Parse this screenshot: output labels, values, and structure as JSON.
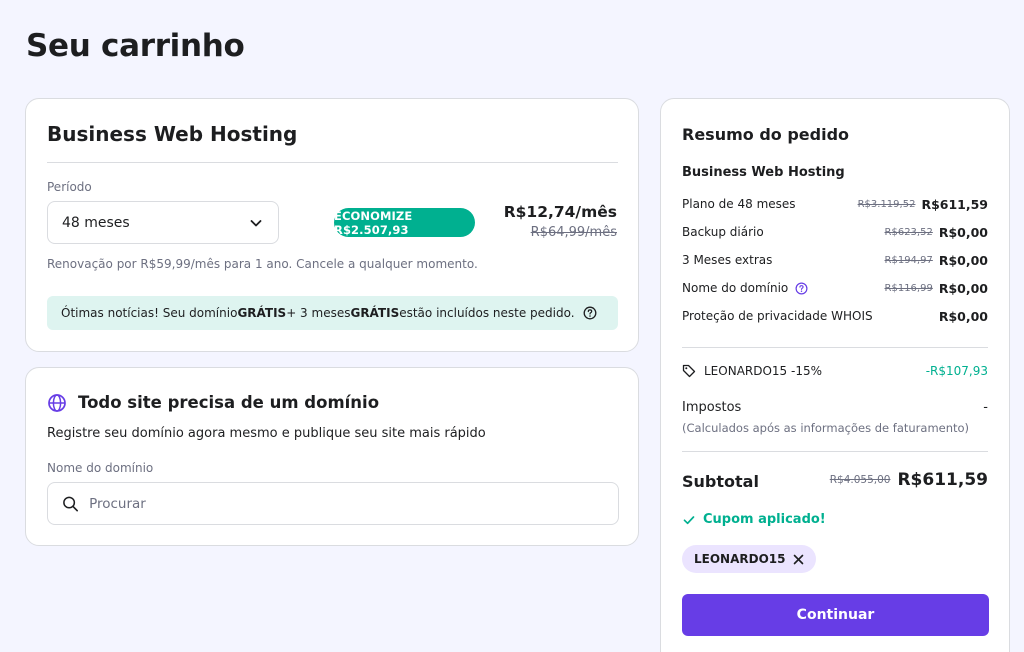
{
  "page": {
    "title": "Seu carrinho"
  },
  "plan": {
    "title": "Business Web Hosting",
    "period_label": "Período",
    "period_value": "48 meses",
    "save_badge": "ECONOMIZE R$2.507,93",
    "price": "R$12,74/mês",
    "old_price": "R$64,99/mês",
    "renewal": "Renovação por R$59,99/mês para 1 ano. Cancele a qualquer momento.",
    "promo": {
      "part1": "Ótimas notícias! Seu domínio ",
      "bold1": "GRÁTIS",
      "part2": " + 3 meses ",
      "bold2": "GRÁTIS",
      "part3": " estão incluídos neste pedido."
    }
  },
  "domain": {
    "title": "Todo site precisa de um domínio",
    "subtitle": "Registre seu domínio agora mesmo e publique seu site mais rápido",
    "label": "Nome do domínio",
    "placeholder": "Procurar"
  },
  "summary": {
    "title": "Resumo do pedido",
    "product": "Business Web Hosting",
    "items": [
      {
        "label": "Plano de 48 meses",
        "old": "R$3.119,52",
        "price": "R$611,59"
      },
      {
        "label": "Backup diário",
        "old": "R$623,52",
        "price": "R$0,00"
      },
      {
        "label": "3 Meses extras",
        "old": "R$194,97",
        "price": "R$0,00"
      },
      {
        "label": "Nome do domínio",
        "old": "R$116,99",
        "price": "R$0,00"
      },
      {
        "label": "Proteção de privacidade WHOIS",
        "old": "",
        "price": "R$0,00"
      }
    ],
    "coupon_line": "LEONARDO15 -15%",
    "discount": "-R$107,93",
    "tax_label": "Impostos",
    "tax_value": "-",
    "tax_note": "(Calculados após as informações de faturamento)",
    "subtotal_label": "Subtotal",
    "subtotal_old": "R$4.055,00",
    "subtotal_value": "R$611,59",
    "coupon_applied": "Cupom aplicado!",
    "coupon_code": "LEONARDO15",
    "continue_label": "Continuar"
  },
  "colors": {
    "accent": "#673de6",
    "success": "#00b090",
    "background": "#f4f5ff"
  },
  "icons": [
    "chevron-down-icon",
    "help-icon",
    "globe-icon",
    "search-icon",
    "info-icon",
    "tag-icon",
    "check-icon",
    "close-icon"
  ]
}
